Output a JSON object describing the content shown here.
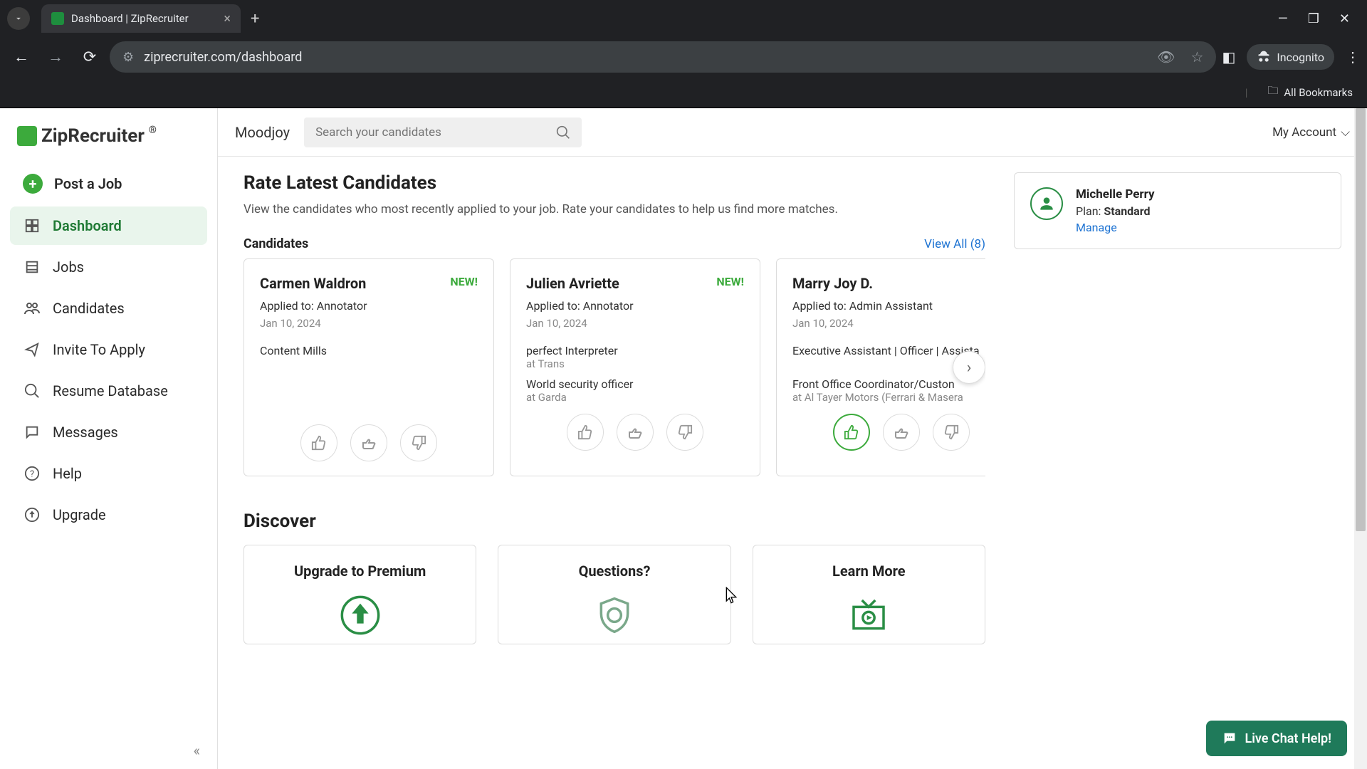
{
  "browser": {
    "tab_title": "Dashboard | ZipRecruiter",
    "url": "ziprecruiter.com/dashboard",
    "incognito_label": "Incognito",
    "bookmarks_label": "All Bookmarks"
  },
  "logo_text": "ZipRecruiter",
  "sidebar": {
    "items": [
      {
        "label": "Post a Job"
      },
      {
        "label": "Dashboard"
      },
      {
        "label": "Jobs"
      },
      {
        "label": "Candidates"
      },
      {
        "label": "Invite To Apply"
      },
      {
        "label": "Resume Database"
      },
      {
        "label": "Messages"
      },
      {
        "label": "Help"
      },
      {
        "label": "Upgrade"
      }
    ]
  },
  "topbar": {
    "org_name": "Moodjoy",
    "search_placeholder": "Search your candidates",
    "account_label": "My Account"
  },
  "rate_section": {
    "title": "Rate Latest Candidates",
    "subtitle": "View the candidates who most recently applied to your job. Rate your candidates to help us find more matches."
  },
  "candidates_header": {
    "label": "Candidates",
    "view_all": "View All (8)"
  },
  "candidates": [
    {
      "name": "Carmen Waldron",
      "is_new": true,
      "new_label": "NEW!",
      "applied_to": "Applied to: Annotator",
      "date": "Jan 10, 2024",
      "exp": [
        {
          "title": "Content Mills",
          "sub": ""
        }
      ],
      "liked": false
    },
    {
      "name": "Julien Avriette",
      "is_new": true,
      "new_label": "NEW!",
      "applied_to": "Applied to: Annotator",
      "date": "Jan 10, 2024",
      "exp": [
        {
          "title": "perfect Interpreter",
          "sub": "at Trans"
        },
        {
          "title": "World security officer",
          "sub": "at Garda"
        }
      ],
      "liked": false
    },
    {
      "name": "Marry Joy D.",
      "is_new": false,
      "new_label": "",
      "applied_to": "Applied to: Admin Assistant",
      "date": "Jan 10, 2024",
      "exp": [
        {
          "title": "Executive Assistant | Officer | Assista",
          "sub": ""
        },
        {
          "title": "Front Office Coordinator/Custon",
          "sub": "at Al Tayer Motors (Ferrari & Masera"
        }
      ],
      "liked": true
    }
  ],
  "discover": {
    "title": "Discover",
    "cards": [
      {
        "title": "Upgrade to Premium"
      },
      {
        "title": "Questions?"
      },
      {
        "title": "Learn More"
      }
    ]
  },
  "account_box": {
    "name": "Michelle Perry",
    "plan_label": "Plan:",
    "plan_value": "Standard",
    "manage": "Manage"
  },
  "chat": {
    "label": "Live Chat Help!"
  }
}
